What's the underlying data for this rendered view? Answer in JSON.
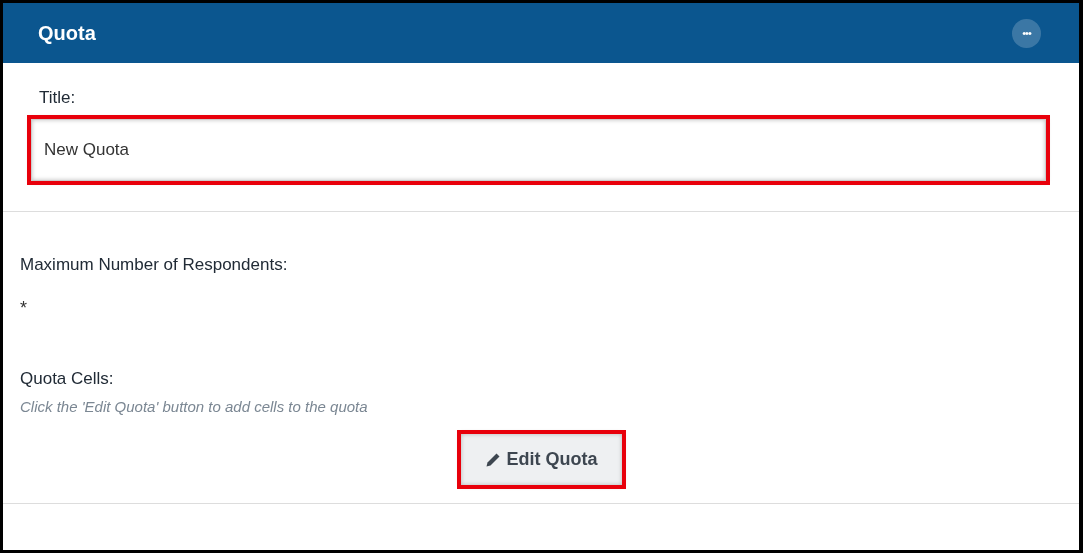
{
  "header": {
    "title": "Quota",
    "menu_button": "•••"
  },
  "title_field": {
    "label": "Title:",
    "value": "New Quota",
    "highlighted": true
  },
  "max_respondents": {
    "label": "Maximum Number of Respondents:",
    "value": "*"
  },
  "quota_cells": {
    "label": "Quota Cells:",
    "hint": "Click the 'Edit Quota' button to add cells to the quota"
  },
  "edit_button": {
    "label": "Edit Quota",
    "highlighted": true
  }
}
